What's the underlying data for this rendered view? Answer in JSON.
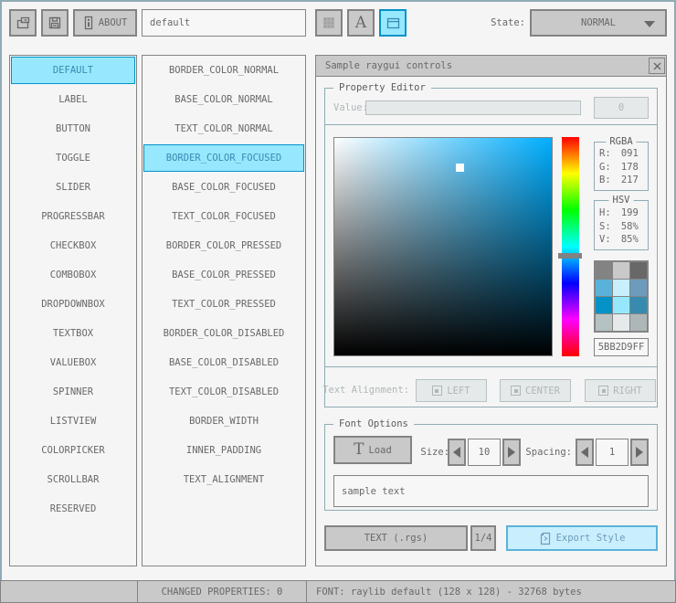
{
  "toolbar": {
    "about_label": "ABOUT",
    "style_name": "default",
    "state_label": "State:",
    "state_value": "NORMAL"
  },
  "controls_list": {
    "selected": "DEFAULT",
    "items": [
      "DEFAULT",
      "LABEL",
      "BUTTON",
      "TOGGLE",
      "SLIDER",
      "PROGRESSBAR",
      "CHECKBOX",
      "COMBOBOX",
      "DROPDOWNBOX",
      "TEXTBOX",
      "VALUEBOX",
      "SPINNER",
      "LISTVIEW",
      "COLORPICKER",
      "SCROLLBAR",
      "RESERVED"
    ]
  },
  "properties_list": {
    "selected": "BORDER_COLOR_FOCUSED",
    "items": [
      "BORDER_COLOR_NORMAL",
      "BASE_COLOR_NORMAL",
      "TEXT_COLOR_NORMAL",
      "BORDER_COLOR_FOCUSED",
      "BASE_COLOR_FOCUSED",
      "TEXT_COLOR_FOCUSED",
      "BORDER_COLOR_PRESSED",
      "BASE_COLOR_PRESSED",
      "TEXT_COLOR_PRESSED",
      "BORDER_COLOR_DISABLED",
      "BASE_COLOR_DISABLED",
      "TEXT_COLOR_DISABLED",
      "BORDER_WIDTH",
      "INNER_PADDING",
      "TEXT_ALIGNMENT"
    ]
  },
  "window": {
    "title": "Sample raygui controls"
  },
  "property_editor": {
    "label": "Property Editor",
    "value_label": "Value:",
    "value_text": "",
    "value_button": "0",
    "color_picker": {
      "hex": "5BB2D9FF",
      "rgba": {
        "label": "RGBA",
        "r_label": "R:",
        "r": "091",
        "g_label": "G:",
        "g": "178",
        "b_label": "B:",
        "b": "217"
      },
      "hsv": {
        "label": "HSV",
        "h_label": "H:",
        "h": "199",
        "s_label": "S:",
        "s": "58%",
        "v_label": "V:",
        "v": "85%"
      },
      "style_palette": {
        "items": [
          "#838383",
          "#c9c9c9",
          "#686868",
          "#5bb2d9",
          "#c9effe",
          "#6c9bbc",
          "#0492c7",
          "#97e8ff",
          "#368baf",
          "#b5c1c2",
          "#e6e9e9",
          "#aeb7b8"
        ]
      }
    },
    "alignment": {
      "label": "Text Alignment:",
      "left": "LEFT",
      "center": "CENTER",
      "right": "RIGHT"
    }
  },
  "font_options": {
    "label": "Font Options",
    "load_icon_glyph": "T",
    "load_label": "Load",
    "size_label": "Size:",
    "size_value": "10",
    "spacing_label": "Spacing:",
    "spacing_value": "1",
    "sample_text": "sample text"
  },
  "export_row": {
    "format_button": "TEXT (.rgs)",
    "pager": "1/4",
    "export_button": "Export Style"
  },
  "statusbar": {
    "changed_properties": "CHANGED PROPERTIES: 0",
    "font_info": "FONT: raylib default (128 x 128) - 32768 bytes"
  },
  "colors": {
    "background": "#f5f5f5",
    "line": "#90abb5",
    "border_normal": "#838383",
    "base_normal": "#c9c9c9",
    "text_normal": "#686868",
    "border_focused": "#5bb2d9",
    "base_focused": "#c9effe",
    "text_focused": "#6c9bbc",
    "border_pressed": "#0492c7",
    "base_pressed": "#97e8ff",
    "text_pressed": "#368baf",
    "border_disabled": "#b5c1c2",
    "base_disabled": "#e6e9e9",
    "text_disabled": "#aeb7b8",
    "picker_selected_hex": "#5bb2d9"
  }
}
